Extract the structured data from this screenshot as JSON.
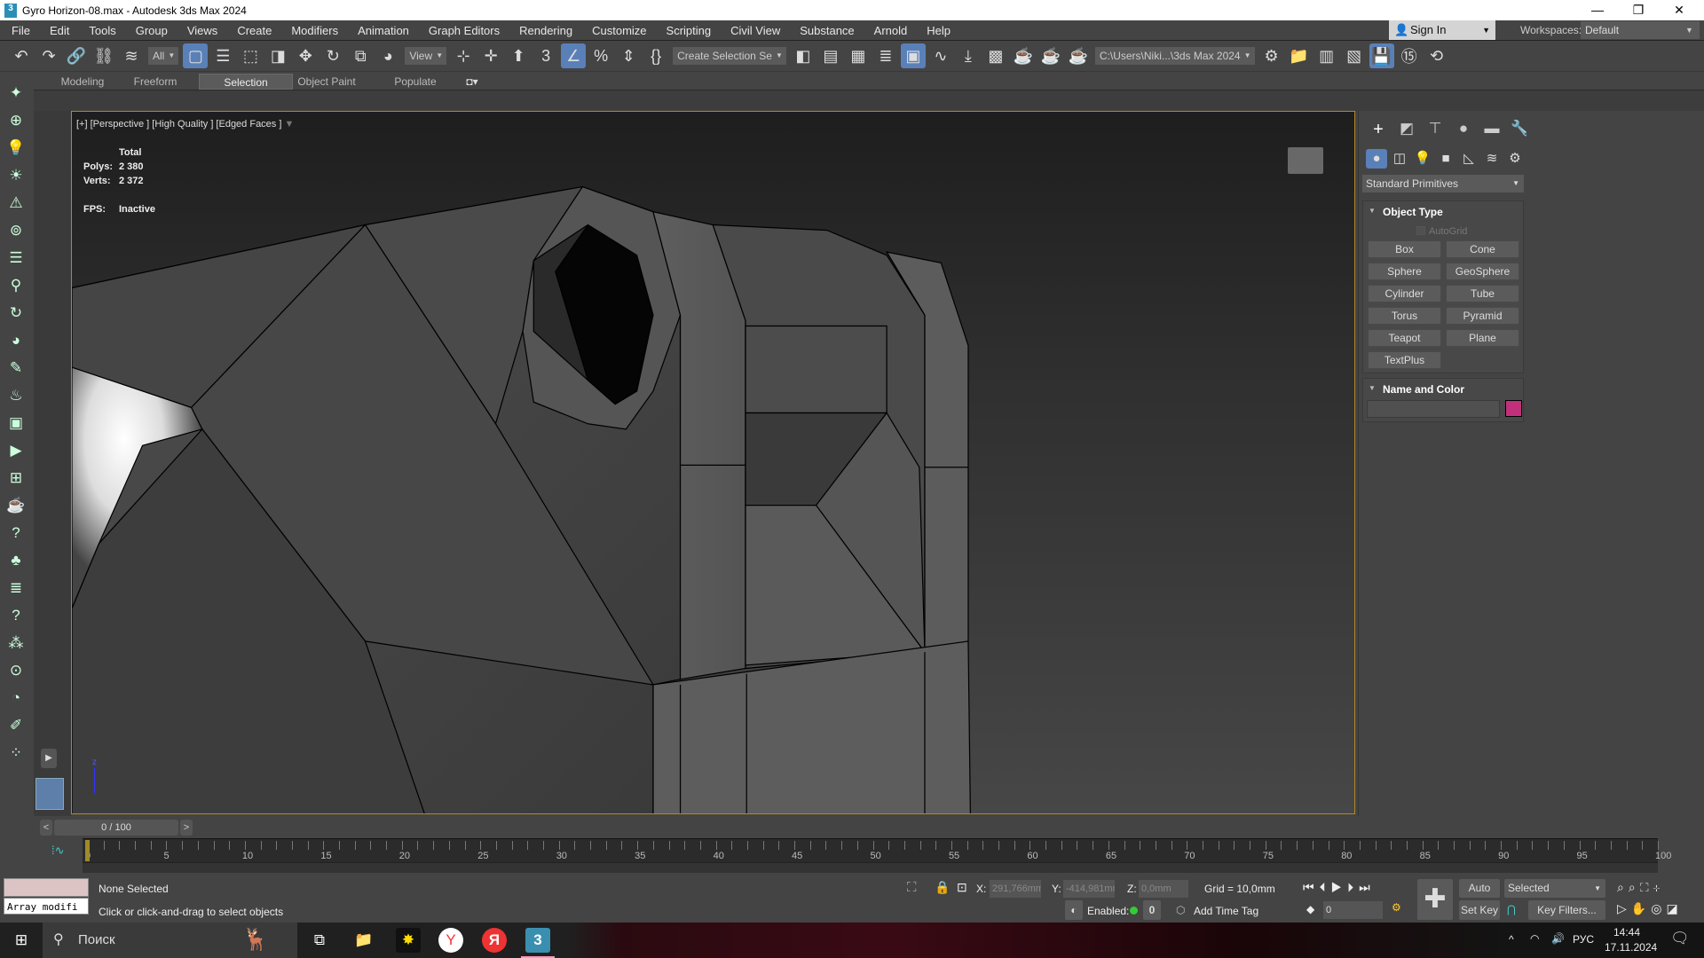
{
  "window": {
    "title": "Gyro Horizon-08.max - Autodesk 3ds Max 2024",
    "app_icon": "3",
    "minimize": "—",
    "restore": "❐",
    "close": "✕"
  },
  "menu": [
    "File",
    "Edit",
    "Tools",
    "Group",
    "Views",
    "Create",
    "Modifiers",
    "Animation",
    "Graph Editors",
    "Rendering",
    "Customize",
    "Scripting",
    "Civil View",
    "Substance",
    "Arnold",
    "Help"
  ],
  "account": {
    "sign_in": "Sign In",
    "workspaces_label": "Workspaces:",
    "workspace": "Default"
  },
  "toolbar": [
    {
      "t": "icon",
      "name": "undo-icon",
      "g": "↶"
    },
    {
      "t": "icon",
      "name": "redo-icon",
      "g": "↷"
    },
    {
      "t": "icon",
      "name": "link-icon",
      "g": "🔗"
    },
    {
      "t": "icon",
      "name": "unlink-icon",
      "g": "⛓"
    },
    {
      "t": "icon",
      "name": "bind-space-warp-icon",
      "g": "≋"
    },
    {
      "t": "drop",
      "name": "selection-filter-dropdown",
      "v": "All"
    },
    {
      "t": "icon",
      "name": "select-object-icon",
      "g": "▢",
      "active": true
    },
    {
      "t": "icon",
      "name": "select-by-name-icon",
      "g": "☰"
    },
    {
      "t": "icon",
      "name": "rectangular-selection-icon",
      "g": "⬚"
    },
    {
      "t": "icon",
      "name": "window-crossing-icon",
      "g": "◨"
    },
    {
      "t": "icon",
      "name": "select-move-icon",
      "g": "✥"
    },
    {
      "t": "icon",
      "name": "select-rotate-icon",
      "g": "↻"
    },
    {
      "t": "icon",
      "name": "select-scale-icon",
      "g": "⧉"
    },
    {
      "t": "icon",
      "name": "place-icon",
      "g": "◕"
    },
    {
      "t": "drop",
      "name": "reference-coordinate-dropdown",
      "v": "View"
    },
    {
      "t": "icon",
      "name": "pivot-center-icon",
      "g": "⊹"
    },
    {
      "t": "icon",
      "name": "select-manipulate-icon",
      "g": "✛"
    },
    {
      "t": "icon",
      "name": "keyboard-shortcut-override-icon",
      "g": "⬆",
      "active": false
    },
    {
      "t": "icon",
      "name": "snaps-toggle-icon",
      "g": "3"
    },
    {
      "t": "icon",
      "name": "angle-snap-icon",
      "g": "∠",
      "active": true
    },
    {
      "t": "icon",
      "name": "percent-snap-icon",
      "g": "%"
    },
    {
      "t": "icon",
      "name": "spinner-snap-icon",
      "g": "⇕"
    },
    {
      "t": "icon",
      "name": "edit-named-selection-icon",
      "g": "{}"
    },
    {
      "t": "drop",
      "name": "named-selection-dropdown",
      "v": "Create Selection Se"
    },
    {
      "t": "icon",
      "name": "mirror-icon",
      "g": "◧"
    },
    {
      "t": "icon",
      "name": "align-icon",
      "g": "▤"
    },
    {
      "t": "icon",
      "name": "scene-explorer-icon",
      "g": "▦"
    },
    {
      "t": "icon",
      "name": "layer-explorer-icon",
      "g": "≣"
    },
    {
      "t": "icon",
      "name": "toggle-ribbon-icon",
      "g": "▣",
      "active": true
    },
    {
      "t": "icon",
      "name": "curve-editor-icon",
      "g": "∿"
    },
    {
      "t": "icon",
      "name": "dope-sheet-icon",
      "g": "⤓"
    },
    {
      "t": "icon",
      "name": "material-editor-icon",
      "g": "▩"
    },
    {
      "t": "icon",
      "name": "render-setup-icon",
      "g": "☕"
    },
    {
      "t": "icon",
      "name": "rendered-frame-window-icon",
      "g": "☕"
    },
    {
      "t": "icon",
      "name": "render-production-icon",
      "g": "☕"
    },
    {
      "t": "drop",
      "name": "project-folder-dropdown",
      "v": "C:\\Users\\Niki...\\3ds Max 2024"
    },
    {
      "t": "icon",
      "name": "project-settings-icon",
      "g": "⚙"
    },
    {
      "t": "icon",
      "name": "project-folder-icon",
      "g": "📁"
    },
    {
      "t": "icon",
      "name": "project-manager-icon",
      "g": "▥"
    },
    {
      "t": "icon",
      "name": "project-structure-icon",
      "g": "▧"
    },
    {
      "t": "icon",
      "name": "autobackup-icon",
      "g": "💾",
      "active": true
    },
    {
      "t": "icon",
      "name": "autobackup-interval-icon",
      "g": "⑮"
    },
    {
      "t": "icon",
      "name": "restore-backup-icon",
      "g": "⟲"
    }
  ],
  "ribbon_tabs": [
    {
      "label": "Modeling"
    },
    {
      "label": "Freeform"
    },
    {
      "label": "Selection",
      "active": true
    },
    {
      "label": "Object Paint"
    },
    {
      "label": "Populate"
    }
  ],
  "left_tools": [
    "create-icon",
    "hierarchy-icon",
    "light-icon",
    "sun-icon",
    "camera-icon",
    "helpers-icon",
    "list-icon",
    "bulb-icon",
    "rotate-tool-icon",
    "sphere-icon",
    "paint-icon",
    "bulb2-icon",
    "frame-icon",
    "render-icon",
    "grid-icon",
    "teapot-icon",
    "help-icon",
    "tree-icon",
    "layers-icon",
    "help2-icon",
    "snap-icon",
    "target-icon",
    "isolate-icon",
    "brush-icon",
    "nodes-icon"
  ],
  "viewport": {
    "label": "[+] [Perspective ] [High Quality ] [Edged Faces ]",
    "stats": {
      "header": "Total",
      "polys_label": "Polys:",
      "polys": "2 380",
      "verts_label": "Verts:",
      "verts": "2 372",
      "fps_label": "FPS:",
      "fps": "Inactive"
    },
    "axis_label": "z"
  },
  "command_panel": {
    "tabs": [
      "create-tab-icon",
      "modify-tab-icon",
      "hierarchy-tab-icon",
      "motion-tab-icon",
      "display-tab-icon",
      "utilities-tab-icon"
    ],
    "subtabs": [
      "geometry-icon",
      "shapes-icon",
      "lights-icon",
      "cameras-icon",
      "helpers-icon",
      "space-warps-icon",
      "systems-icon"
    ],
    "category": "Standard Primitives",
    "object_type": {
      "title": "Object Type",
      "autogrid": "AutoGrid",
      "buttons": [
        "Box",
        "Cone",
        "Sphere",
        "GeoSphere",
        "Cylinder",
        "Tube",
        "Torus",
        "Pyramid",
        "Teapot",
        "Plane",
        "TextPlus"
      ]
    },
    "name_color": {
      "title": "Name and Color",
      "name": "",
      "color": "#c2307c"
    }
  },
  "timeline": {
    "frame_display": "0 / 100",
    "prev": "<",
    "next": ">",
    "start": 0,
    "end": 100,
    "current": 0
  },
  "status": {
    "selection": "None Selected",
    "prompt": "Click or click-and-drag to select objects",
    "maxscript": "Array modifi",
    "x_label": "X:",
    "x": "291,766mm",
    "y_label": "Y:",
    "y": "-414,981mm",
    "z_label": "Z:",
    "z": "0,0mm",
    "grid": "Grid = 10,0mm",
    "enabled_label": "Enabled:",
    "enabled_value": "0",
    "add_time_tag": "Add Time Tag",
    "auto_key": "Auto Key",
    "set_key": "Set Key",
    "key_mode": "Selected",
    "key_filters": "Key Filters...",
    "frame": "0"
  },
  "taskbar": {
    "search": "Поиск",
    "lang": "РУС",
    "time": "14:44",
    "date": "17.11.2024"
  }
}
